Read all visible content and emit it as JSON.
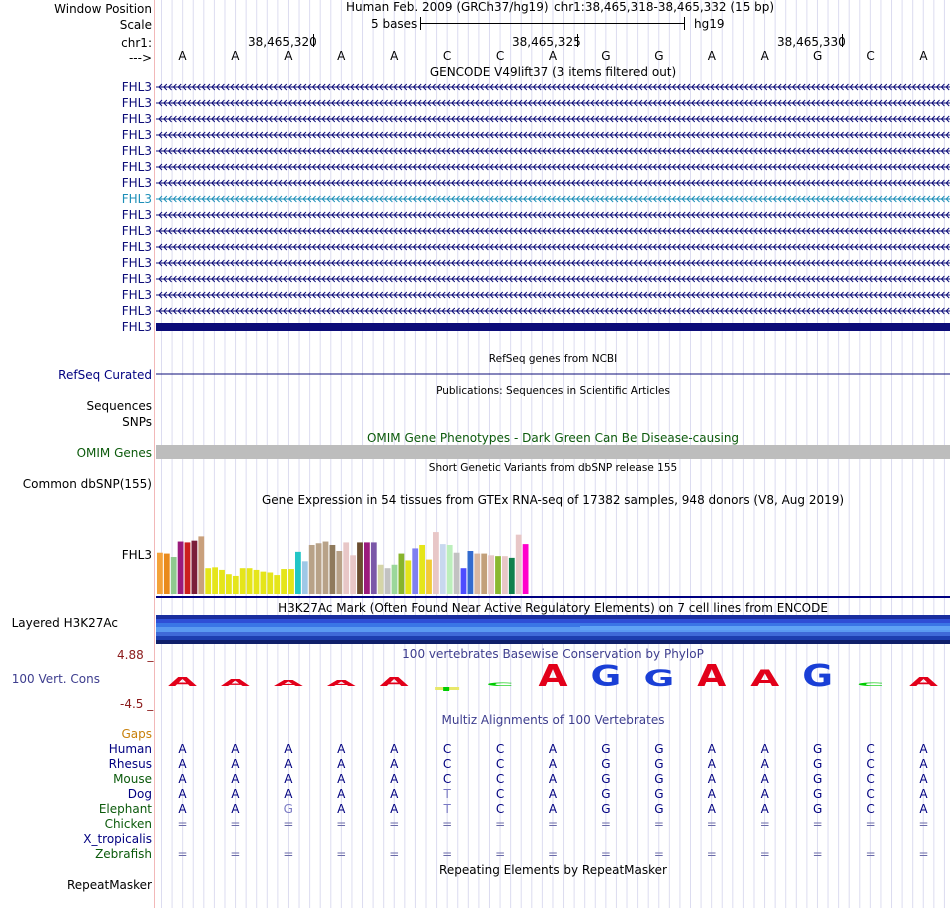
{
  "header": {
    "window_position_label": "Window Position",
    "scale_label": "Scale",
    "chrom_label": "chr1:",
    "strand_label": "--->",
    "assembly": "Human Feb. 2009 (GRCh37/hg19)",
    "position": "chr1:38,465,318-38,465,332 (15 bp)",
    "scale_bases": "5 bases",
    "scale_db": "hg19",
    "ticks": [
      "38,465,320",
      "38,465,325",
      "38,465,330"
    ],
    "bases": [
      "A",
      "A",
      "A",
      "A",
      "A",
      "C",
      "C",
      "A",
      "G",
      "G",
      "A",
      "A",
      "G",
      "C",
      "A"
    ]
  },
  "gencode": {
    "title": "GENCODE V49lift37 (3 items filtered out)",
    "gene_label": "FHL3",
    "row_count": 16,
    "highlight_row": 7,
    "colors": {
      "gene": "#0c0c78",
      "highlight": "#1d8fb8"
    }
  },
  "refseq": {
    "title": "RefSeq genes from NCBI",
    "label": "RefSeq Curated"
  },
  "publications": {
    "title": "Publications: Sequences in Scientific Articles",
    "label_sequences": "Sequences",
    "label_snps": "SNPs"
  },
  "omim": {
    "title": "OMIM Gene Phenotypes - Dark Green Can Be Disease-causing",
    "label": "OMIM Genes",
    "color": "#bdbdbd"
  },
  "dbsnp": {
    "title": "Short Genetic Variants from dbSNP release 155",
    "label": "Common dbSNP(155)"
  },
  "gtex": {
    "title": "Gene Expression in 54 tissues from GTEx RNA-seq of 17382 samples, 948 donors (V8, Aug 2019)",
    "label": "FHL3",
    "values": [
      0.48,
      0.47,
      0.43,
      0.61,
      0.6,
      0.62,
      0.67,
      0.3,
      0.31,
      0.28,
      0.23,
      0.21,
      0.3,
      0.3,
      0.28,
      0.26,
      0.25,
      0.22,
      0.29,
      0.29,
      0.49,
      0.38,
      0.57,
      0.59,
      0.61,
      0.57,
      0.5,
      0.6,
      0.45,
      0.6,
      0.6,
      0.6,
      0.34,
      0.3,
      0.34,
      0.47,
      0.39,
      0.53,
      0.57,
      0.4,
      0.72,
      0.58,
      0.57,
      0.48,
      0.3,
      0.5,
      0.47,
      0.47,
      0.45,
      0.44,
      0.44,
      0.42,
      0.69,
      0.58
    ],
    "colors": [
      "#f4a23a",
      "#e98a1c",
      "#8fc98f",
      "#9b1b7d",
      "#cc1f1f",
      "#7b1f3a",
      "#c9a07c",
      "#e5e51a",
      "#e5e51a",
      "#e5e51a",
      "#e5e51a",
      "#e5e51a",
      "#e5e51a",
      "#e5e51a",
      "#e5e51a",
      "#e5e51a",
      "#e5e51a",
      "#e5e51a",
      "#e5e51a",
      "#e5e51a",
      "#22c6c6",
      "#9ec8e6",
      "#b8a288",
      "#b8a288",
      "#b8a288",
      "#8f7a5c",
      "#b8a288",
      "#e8c7c7",
      "#e8c7c7",
      "#6a4d2f",
      "#9b1b7d",
      "#7b57a8",
      "#d5d5a8",
      "#c2c2c2",
      "#9bd79b",
      "#88b42c",
      "#e5e51a",
      "#7f7ff0",
      "#e5e51a",
      "#f2ca36",
      "#e8c7c7",
      "#c8d8ef",
      "#bcefbc",
      "#c2c2c2",
      "#4d4dff",
      "#336bcf",
      "#d9b8a2",
      "#c2a07a",
      "#e8c7c7",
      "#8ab82f",
      "#e8c7c7",
      "#11804d",
      "#e8c7c7",
      "#ff00cc"
    ]
  },
  "h3k27ac": {
    "title": "H3K27Ac Mark (Often Found Near Active Regulatory Elements) on 7 cell lines from ENCODE",
    "label": "Layered H3K27Ac",
    "colors": [
      "#1a2e9e",
      "#2f4fd6",
      "#3a76e6",
      "#5a9af0",
      "#3f6ad8",
      "#1d3fb0",
      "#10206a"
    ]
  },
  "phylop": {
    "title": "100 vertebrates Basewise Conservation by PhyloP",
    "label": "100 Vert. Cons",
    "max_label": "4.88 _",
    "min_label": "-4.5 _",
    "logo": [
      {
        "base": "A",
        "score": 0.9
      },
      {
        "base": "A",
        "score": 0.7
      },
      {
        "base": "A",
        "score": 0.6
      },
      {
        "base": "A",
        "score": 0.6
      },
      {
        "base": "A",
        "score": 0.9
      },
      {
        "base": "C",
        "score": -0.15
      },
      {
        "base": "C",
        "score": 0.35
      },
      {
        "base": "A",
        "score": 2.2
      },
      {
        "base": "G",
        "score": 2.1
      },
      {
        "base": "G",
        "score": 1.6
      },
      {
        "base": "A",
        "score": 2.2
      },
      {
        "base": "A",
        "score": 1.6
      },
      {
        "base": "G",
        "score": 2.2
      },
      {
        "base": "C",
        "score": 0.35
      },
      {
        "base": "A",
        "score": 0.9
      }
    ],
    "colors": {
      "A": "#e2001a",
      "C": "#00cc00",
      "G": "#1a3fd6",
      "neg": "#e8e86a"
    }
  },
  "multiz": {
    "title": "Multiz Alignments of 100 Vertebrates",
    "gaps_label": "Gaps",
    "species": [
      {
        "name": "Human",
        "color": "#000080",
        "seq": [
          "A",
          "A",
          "A",
          "A",
          "A",
          "C",
          "C",
          "A",
          "G",
          "G",
          "A",
          "A",
          "G",
          "C",
          "A"
        ]
      },
      {
        "name": "Rhesus",
        "color": "#000080",
        "seq": [
          "A",
          "A",
          "A",
          "A",
          "A",
          "C",
          "C",
          "A",
          "G",
          "G",
          "A",
          "A",
          "G",
          "C",
          "A"
        ]
      },
      {
        "name": "Mouse",
        "color": "#0b5a0b",
        "seq": [
          "A",
          "A",
          "A",
          "A",
          "A",
          "C",
          "C",
          "A",
          "G",
          "G",
          "A",
          "A",
          "G",
          "C",
          "A"
        ]
      },
      {
        "name": "Dog",
        "color": "#000080",
        "seq": [
          "A",
          "A",
          "A",
          "A",
          "A",
          "T",
          "C",
          "A",
          "G",
          "G",
          "A",
          "A",
          "G",
          "C",
          "A"
        ]
      },
      {
        "name": "Elephant",
        "color": "#0b5a0b",
        "seq": [
          "A",
          "A",
          "G",
          "A",
          "A",
          "T",
          "C",
          "A",
          "G",
          "G",
          "A",
          "A",
          "G",
          "C",
          "A"
        ]
      },
      {
        "name": "Chicken",
        "color": "#0b5a0b",
        "seq": [
          "=",
          "=",
          "=",
          "=",
          "=",
          "=",
          "=",
          "=",
          "=",
          "=",
          "=",
          "=",
          "=",
          "=",
          "="
        ]
      },
      {
        "name": "X_tropicalis",
        "color": "#000080",
        "seq": [
          "",
          "",
          "",
          "",
          "",
          "",
          "",
          "",
          "",
          "",
          "",
          "",
          "",
          "",
          ""
        ]
      },
      {
        "name": "Zebrafish",
        "color": "#0b5a0b",
        "seq": [
          "=",
          "=",
          "=",
          "=",
          "=",
          "=",
          "=",
          "=",
          "=",
          "=",
          "=",
          "=",
          "=",
          "=",
          "="
        ]
      }
    ],
    "diff_cells": [
      [
        3,
        5
      ],
      [
        4,
        2
      ],
      [
        4,
        5
      ]
    ],
    "colors": {
      "gaps": "#c8800a",
      "diff": "#7a7ac4",
      "eq": "#6a6aa8"
    }
  },
  "repeatmasker": {
    "title": "Repeating Elements by RepeatMasker",
    "label": "RepeatMasker"
  }
}
